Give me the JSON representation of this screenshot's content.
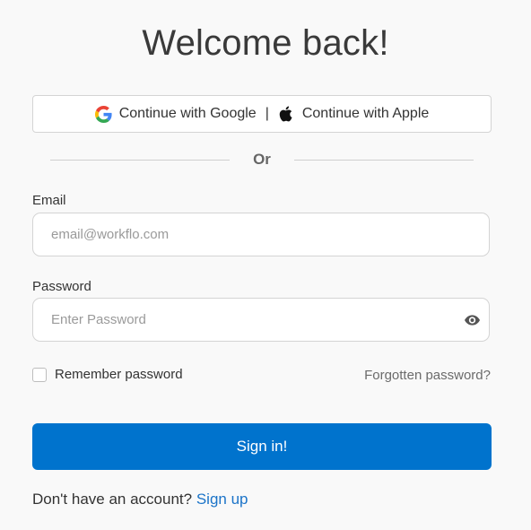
{
  "page": {
    "title": "Welcome back!"
  },
  "sso": {
    "google_label": "Continue with Google",
    "separator": "|",
    "apple_label": "Continue with Apple",
    "google_icon": "google-g-icon",
    "apple_icon": "apple-logo-icon"
  },
  "divider": {
    "text": "Or"
  },
  "email": {
    "label": "Email",
    "value": "",
    "placeholder": "email@workflo.com"
  },
  "password": {
    "label": "Password",
    "value": "",
    "placeholder": "Enter Password",
    "toggle_icon": "eye-icon"
  },
  "options": {
    "remember_label": "Remember password",
    "remember_checked": false,
    "forgot_label": "Forgotten password?"
  },
  "submit": {
    "label": "Sign in!"
  },
  "signup": {
    "prompt": "Don't have an account?",
    "link_label": "Sign up"
  },
  "colors": {
    "primary": "#0073cd",
    "link": "#1a73c8",
    "background": "#f9f9f9",
    "title": "#3a3a3a"
  }
}
